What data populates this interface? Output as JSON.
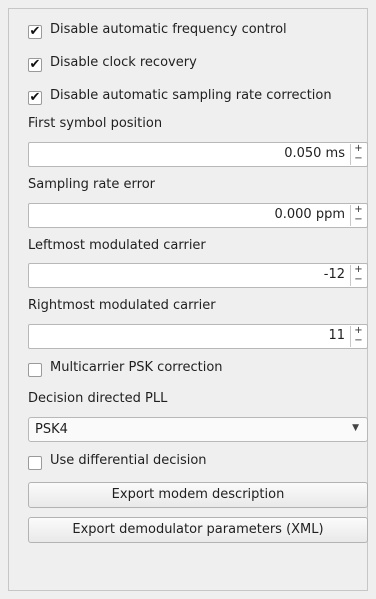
{
  "checkboxes": {
    "afc": {
      "label": "Disable automatic frequency control",
      "checked": true
    },
    "clock": {
      "label": "Disable clock recovery",
      "checked": true
    },
    "sampling": {
      "label": "Disable automatic sampling rate correction",
      "checked": true
    },
    "multicarrier": {
      "label": "Multicarrier PSK correction",
      "checked": false
    },
    "differential": {
      "label": "Use differential decision",
      "checked": false
    }
  },
  "fields": {
    "first_symbol": {
      "label": "First symbol position",
      "value": "0.050 ms"
    },
    "sampling_error": {
      "label": "Sampling rate error",
      "value": "0.000 ppm"
    },
    "leftmost": {
      "label": "Leftmost modulated carrier",
      "value": "-12"
    },
    "rightmost": {
      "label": "Rightmost modulated carrier",
      "value": "11"
    }
  },
  "decision_pll": {
    "label": "Decision directed PLL",
    "value": "PSK4"
  },
  "buttons": {
    "export_modem": "Export modem description",
    "export_params": "Export demodulator parameters (XML)"
  },
  "glyphs": {
    "check": "✔",
    "up": "+",
    "down": "−",
    "dropdown": "▼"
  }
}
